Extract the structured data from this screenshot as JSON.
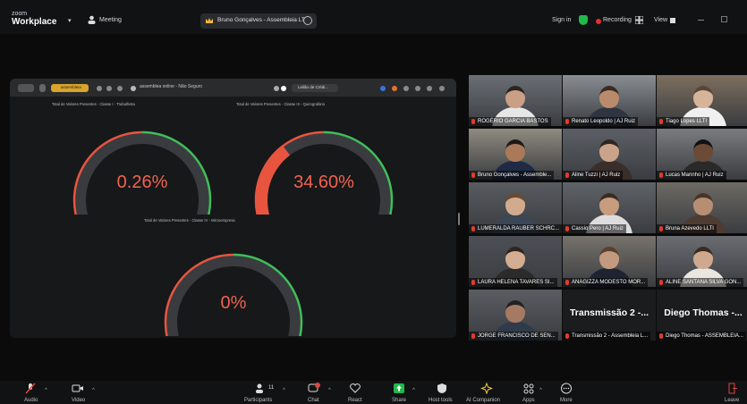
{
  "topbar": {
    "logo_small": "zoom",
    "logo_big": "Workplace",
    "meeting_label": "Meeting",
    "meeting_title": "Bruno Gonçalves - Assembleia LT",
    "sign_in": "Sign in",
    "recording": "Recording",
    "view": "View"
  },
  "browser": {
    "tab_label": "assembleia",
    "url": "assemblea online - Não Seguro",
    "tab2": "Leilão de Crédi..."
  },
  "gauges": [
    {
      "title": "Total de Valores Presentes - Classe I - Trabalhista",
      "value": "0.26%",
      "fraction": 0.0026
    },
    {
      "title": "Total de Valores Presentes - Classe III - Quirografário",
      "value": "34.60%",
      "fraction": 0.346
    },
    {
      "title": "Total de Valores Presentes - Classe IV - Microempresa",
      "value": "0%",
      "fraction": 0.0
    }
  ],
  "participants": [
    {
      "name": "ROGÉRIO GARCIA BASTOS"
    },
    {
      "name": "Renato Leopoldo | AJ Ruiz"
    },
    {
      "name": "Tiago Lopes LLTI"
    },
    {
      "name": "Bruno Gonçalves - Assemble..."
    },
    {
      "name": "Aline Tuzzi | AJ Ruiz"
    },
    {
      "name": "Lucas Marinho | AJ Ruiz"
    },
    {
      "name": "LUMERALDA RAUBER SCHRC..."
    },
    {
      "name": "Cassio Pero | AJ Ruiz"
    },
    {
      "name": "Bruna Azevedo LLTI"
    },
    {
      "name": "LAURA HELENA TAVARES SI..."
    },
    {
      "name": "ANAGIZZA MODESTO MOR..."
    },
    {
      "name": "ALINE SANTANA SILVA GON..."
    },
    {
      "name": "JORGE FRANCISCO DE SEN..."
    },
    {
      "name": "Transmissão 2 - Assembleia L...",
      "big": "Transmissão 2 -..."
    },
    {
      "name": "Diego Thomas - ASSEMBLEIA...",
      "big": "Diego Thomas -..."
    }
  ],
  "toolbar": {
    "audio": "Audio",
    "video": "Video",
    "participants": "Participants",
    "participants_count": "11",
    "chat": "Chat",
    "react": "React",
    "share": "Share",
    "host_tools": "Host tools",
    "ai_companion": "AI Companion",
    "apps": "Apps",
    "more": "More",
    "leave": "Leave"
  },
  "colors": {
    "gauge_red": "#e8553f",
    "gauge_green": "#3fbf5a",
    "gauge_track": "#3a3b3f",
    "share_green": "#22b84b",
    "active_speaker": "#35c46b"
  }
}
